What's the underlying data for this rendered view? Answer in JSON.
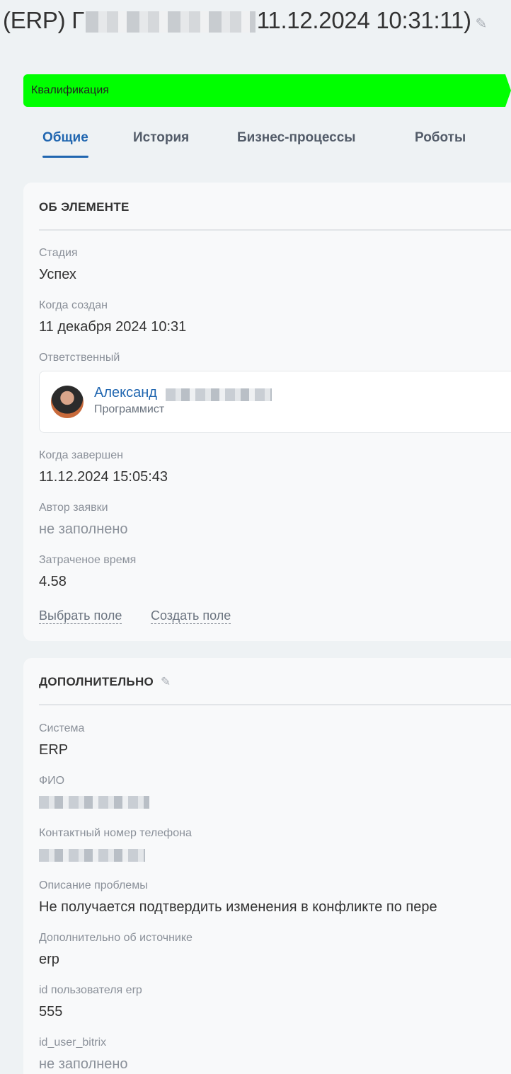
{
  "header": {
    "title_prefix": "(ERP) Г",
    "title_suffix": "11.12.2024 10:31:11)",
    "edit_icon": "pencil-icon"
  },
  "stage": {
    "label": "Квалификация",
    "color": "#00ff00"
  },
  "tabs": [
    {
      "label": "Общие"
    },
    {
      "label": "История"
    },
    {
      "label": "Бизнес-процессы"
    },
    {
      "label": "Роботы"
    }
  ],
  "about": {
    "title": "ОБ ЭЛЕМЕНТЕ",
    "stage_label": "Стадия",
    "stage_value": "Успех",
    "created_label": "Когда создан",
    "created_value": "11 декабря 2024 10:31",
    "responsible_label": "Ответственный",
    "responsible_name": "Александ",
    "responsible_position": "Программист",
    "completed_label": "Когда завершен",
    "completed_value": "11.12.2024 15:05:43",
    "author_label": "Автор заявки",
    "author_value": "не заполнено",
    "spent_label": "Затраченое время",
    "spent_value": "4.58",
    "select_field": "Выбрать поле",
    "create_field": "Создать поле"
  },
  "additional": {
    "title": "ДОПОЛНИТЕЛЬНО",
    "system_label": "Система",
    "system_value": "ERP",
    "fio_label": "ФИО",
    "phone_label": "Контактный номер телефона",
    "problem_label": "Описание проблемы",
    "problem_value": "Не получается подтвердить изменения в конфликте по пере",
    "source_label": "Дополнительно об источнике",
    "source_value": "erp",
    "erp_user_label": "id пользователя erp",
    "erp_user_value": "555",
    "bitrix_user_label": "id_user_bitrix",
    "bitrix_user_value": "не заполнено"
  }
}
